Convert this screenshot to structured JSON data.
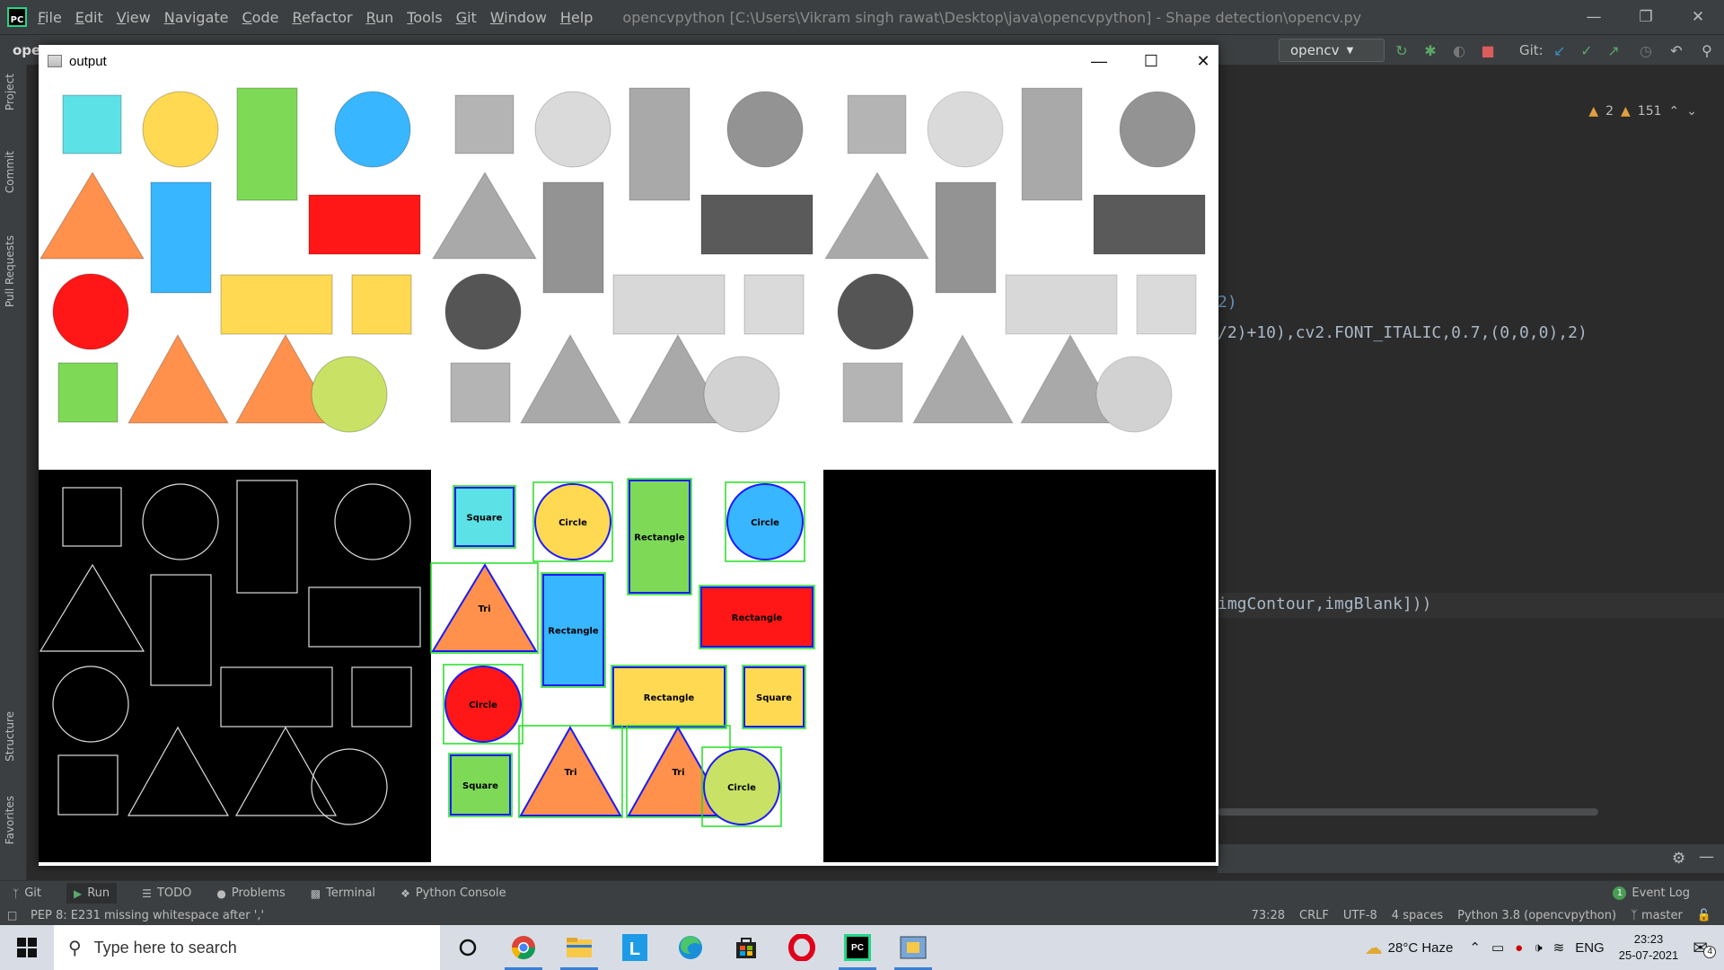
{
  "ide": {
    "menu": [
      "File",
      "Edit",
      "View",
      "Navigate",
      "Code",
      "Refactor",
      "Run",
      "Tools",
      "Git",
      "Window",
      "Help"
    ],
    "title": "opencvpython [C:\\Users\\Vikram singh rawat\\Desktop\\java\\opencvpython] - Shape detection\\opencv.py",
    "project_crumb": "ope",
    "run_config": "opencv",
    "git_label": "Git:",
    "warnings": {
      "a": "2",
      "b": "151"
    },
    "left_tabs": [
      "Project",
      "Commit",
      "Pull Requests",
      "Structure",
      "Favorites"
    ],
    "code_lines": [
      "2)",
      "/2)+10),cv2.FONT_ITALIC,0.7,(0,0,0),2)",
      "imgContour,imgBlank]))"
    ],
    "bottom_tabs": [
      "Git",
      "Run",
      "TODO",
      "Problems",
      "Terminal",
      "Python Console"
    ],
    "event_log": {
      "count": "1",
      "label": "Event Log"
    },
    "status_message": "PEP 8: E231 missing whitespace after ','",
    "status_right": [
      "73:28",
      "CRLF",
      "UTF-8",
      "4 spaces",
      "Python 3.8 (opencvpython)",
      "master"
    ]
  },
  "output_window": {
    "title": "output",
    "labels": {
      "square": "Square",
      "circle": "Circle",
      "rectangle": "Rectangle",
      "tri": "Tri"
    }
  },
  "taskbar": {
    "search_placeholder": "Type here to search",
    "weather": "28°C  Haze",
    "lang": "ENG",
    "time": "23:23",
    "date": "25-07-2021",
    "notifications": "4"
  },
  "colors": {
    "cyan": "#5ce1e6",
    "yellow": "#ffd952",
    "green": "#7ed957",
    "blue": "#38b6ff",
    "red": "#ff1717",
    "orange": "#ff914d",
    "lime": "#c9e265"
  }
}
